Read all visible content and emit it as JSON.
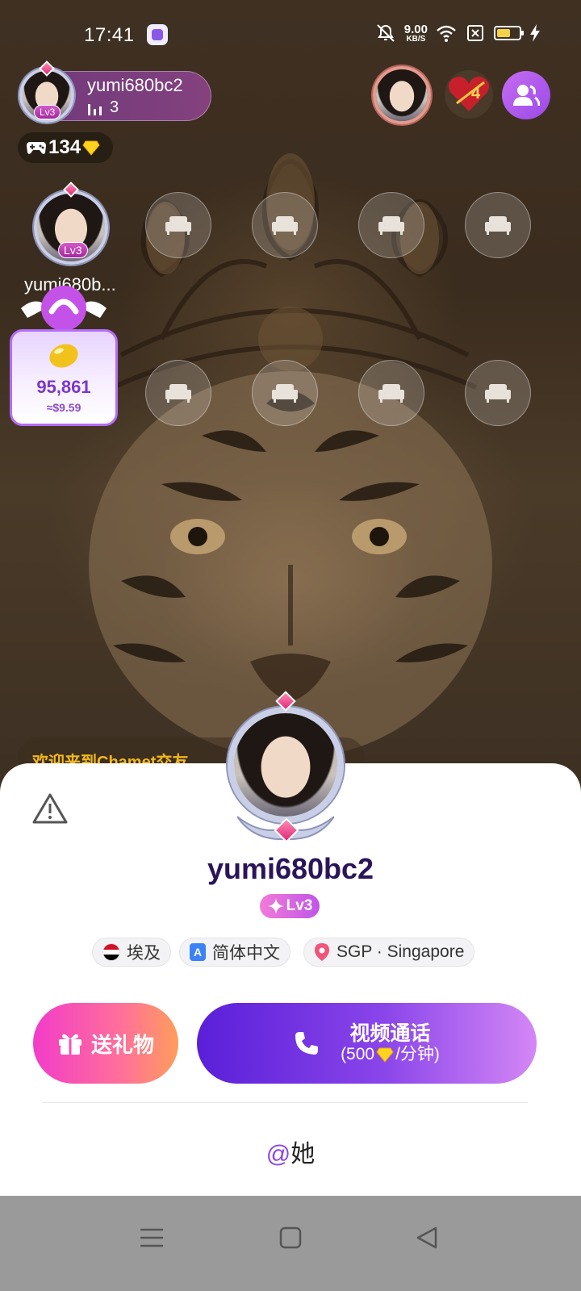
{
  "status_bar": {
    "time": "17:41",
    "net_speed_value": "9.00",
    "net_speed_unit": "KB/S",
    "battery_level": 0.6,
    "icons": [
      "app-icon",
      "mute-icon",
      "wifi-icon",
      "sim-off-icon",
      "battery-icon",
      "charging-icon"
    ]
  },
  "room": {
    "host_name": "yumi680bc2",
    "host_level": "Lv3",
    "viewer_count": "3",
    "game_count": "134",
    "seat_user_name": "yumi680b...",
    "seat_user_level": "Lv3",
    "coin_amount": "95,861",
    "coin_usd": "≈$9.59",
    "welcome_text": "欢迎来到Chamet交友"
  },
  "profile": {
    "name": "yumi680bc2",
    "level": "Lv3",
    "country": "埃及",
    "language": "简体中文",
    "language_icon_letter": "A",
    "location": "SGP · Singapore",
    "gift_button_label": "送礼物",
    "call_button_title": "视频通话",
    "call_price_prefix": "(500",
    "call_price_suffix": "/分钟)",
    "mention_at": "@",
    "mention_text": "她"
  },
  "colors": {
    "accent_purple": "#8a45ea",
    "gift_gradient_start": "#f23cc9",
    "gift_gradient_end": "#ff9d5c",
    "welcome_text": "#f2b81c",
    "name_dark": "#2a1559"
  }
}
